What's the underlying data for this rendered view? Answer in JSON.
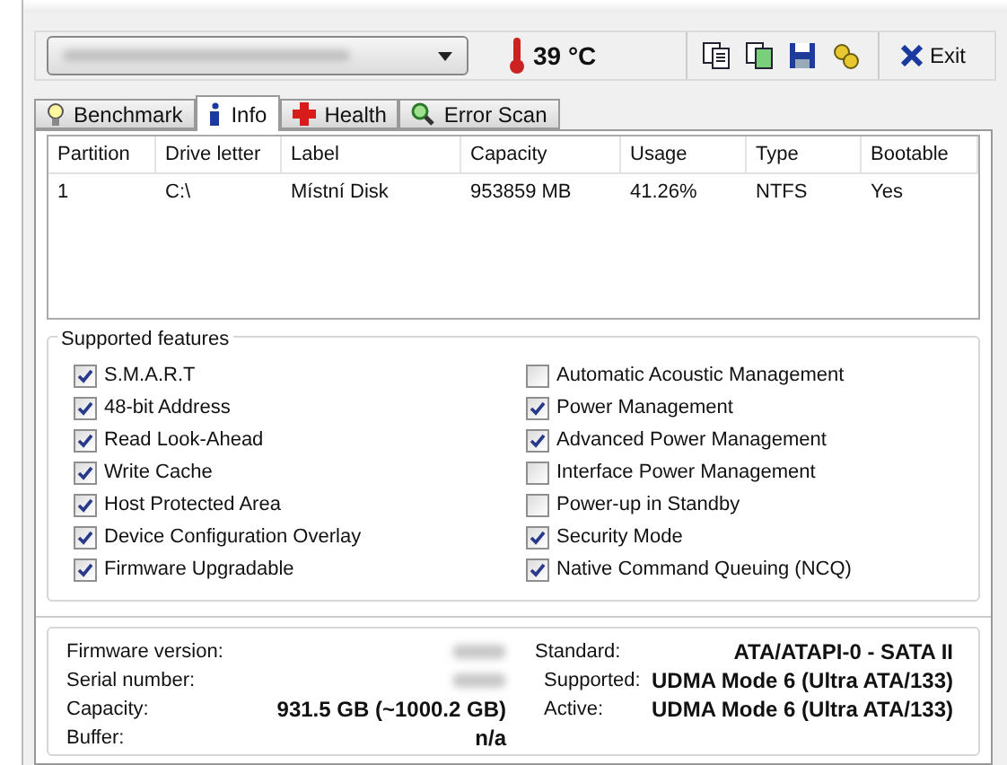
{
  "toolbar": {
    "drive_select": {
      "kind": "redacted"
    },
    "temperature": "39 °C",
    "exit_label": "Exit"
  },
  "tabs": [
    {
      "label": "Benchmark",
      "selected": false
    },
    {
      "label": "Info",
      "selected": true
    },
    {
      "label": "Health",
      "selected": false
    },
    {
      "label": "Error Scan",
      "selected": false
    }
  ],
  "partition_table": {
    "columns": [
      "Partition",
      "Drive letter",
      "Label",
      "Capacity",
      "Usage",
      "Type",
      "Bootable"
    ],
    "rows": [
      [
        "1",
        "C:\\",
        "Místní Disk",
        "953859 MB",
        "41.26%",
        "NTFS",
        "Yes"
      ]
    ]
  },
  "features": {
    "title": "Supported features",
    "items": [
      {
        "label": "S.M.A.R.T",
        "checked": true
      },
      {
        "label": "48-bit Address",
        "checked": true
      },
      {
        "label": "Read Look-Ahead",
        "checked": true
      },
      {
        "label": "Write Cache",
        "checked": true
      },
      {
        "label": "Host Protected Area",
        "checked": true
      },
      {
        "label": "Device Configuration Overlay",
        "checked": true
      },
      {
        "label": "Firmware Upgradable",
        "checked": true
      },
      {
        "label": "Automatic Acoustic Management",
        "checked": false
      },
      {
        "label": "Power Management",
        "checked": true
      },
      {
        "label": "Advanced Power Management",
        "checked": true
      },
      {
        "label": "Interface Power Management",
        "checked": false
      },
      {
        "label": "Power-up in Standby",
        "checked": false
      },
      {
        "label": "Security Mode",
        "checked": true
      },
      {
        "label": "Native Command Queuing (NCQ)",
        "checked": true
      }
    ]
  },
  "details": {
    "left": [
      {
        "label": "Firmware version:",
        "kind": "redacted"
      },
      {
        "label": "Serial number:",
        "kind": "redacted"
      },
      {
        "label": "Capacity:",
        "kind": "text",
        "value": "931.5 GB (~1000.2 GB)"
      },
      {
        "label": "Buffer:",
        "kind": "text",
        "value": "n/a"
      }
    ],
    "right": [
      {
        "label": "Standard:",
        "value": "ATA/ATAPI-0 - SATA II"
      },
      {
        "label": "Supported:",
        "value": "UDMA Mode 6 (Ultra ATA/133)"
      },
      {
        "label": "Active:",
        "value": "UDMA Mode 6 (Ultra ATA/133)"
      }
    ]
  }
}
